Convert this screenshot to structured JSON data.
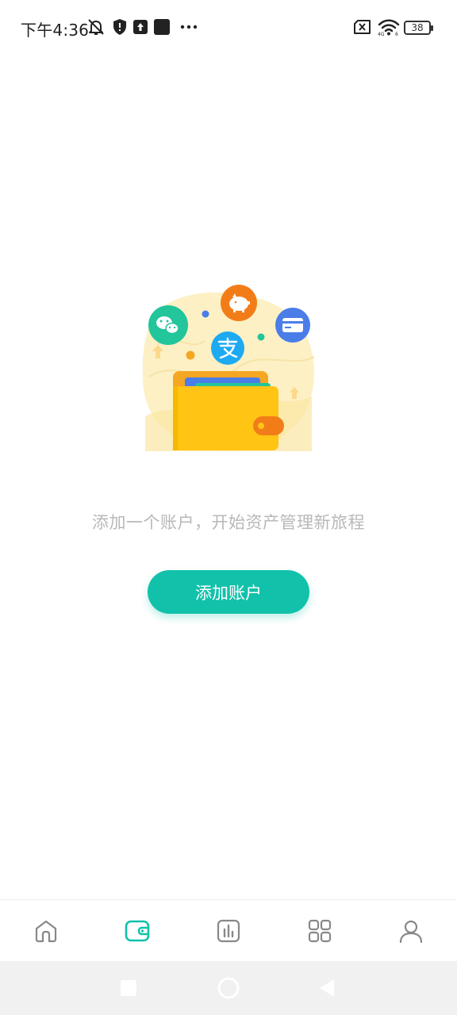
{
  "status_bar": {
    "time": "下午4:36",
    "battery": "38",
    "icons": [
      "bell-off-icon",
      "shield-icon",
      "upload-box-icon",
      "square-icon",
      "more-dots-icon",
      "sim-x-icon",
      "wifi-icon",
      "battery-icon"
    ]
  },
  "empty_state": {
    "message": "添加一个账户，开始资产管理新旅程",
    "button_label": "添加账户"
  },
  "bottom_nav": {
    "items": [
      {
        "icon": "home-icon",
        "active": false
      },
      {
        "icon": "wallet-icon",
        "active": true
      },
      {
        "icon": "chart-icon",
        "active": false
      },
      {
        "icon": "apps-grid-icon",
        "active": false
      },
      {
        "icon": "user-icon",
        "active": false
      }
    ]
  },
  "colors": {
    "accent": "#12c1aa",
    "inactive_icon": "#888888",
    "message_text": "#b8b8b8"
  }
}
